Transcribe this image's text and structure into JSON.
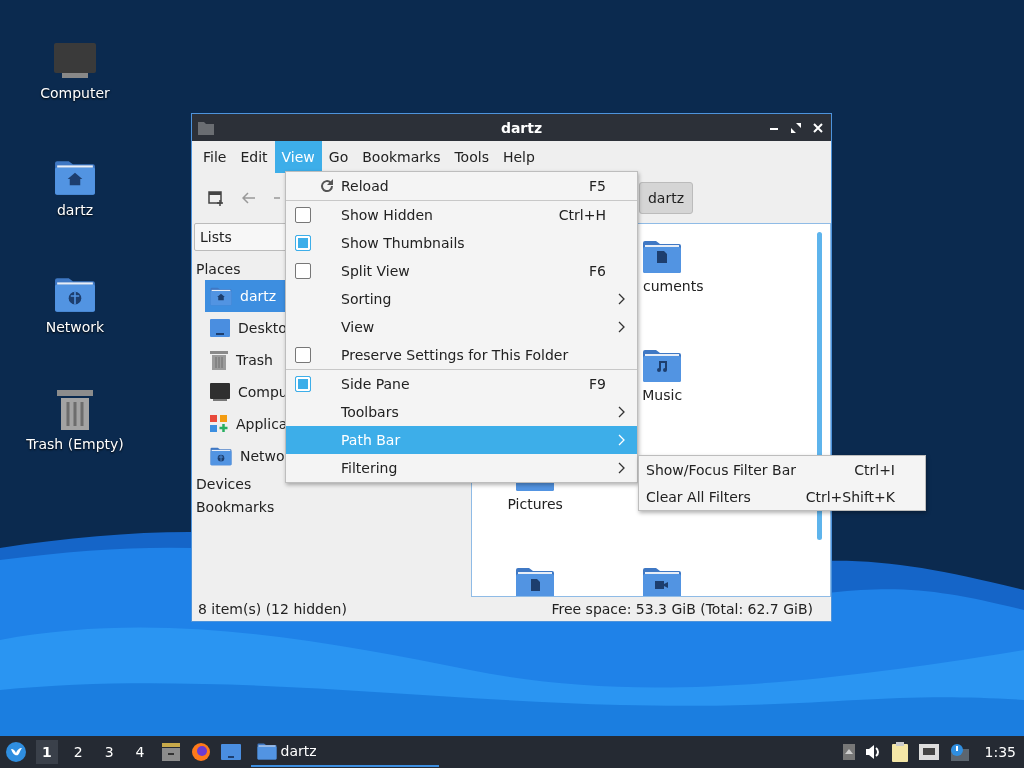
{
  "desktop": {
    "icons": [
      {
        "label": "Computer",
        "kind": "computer"
      },
      {
        "label": "dartz",
        "kind": "home"
      },
      {
        "label": "Network",
        "kind": "network"
      },
      {
        "label": "Trash (Empty)",
        "kind": "trash"
      }
    ]
  },
  "window": {
    "title": "dartz",
    "menubar": [
      {
        "label": "File",
        "selected": false
      },
      {
        "label": "Edit",
        "selected": false
      },
      {
        "label": "View",
        "selected": true
      },
      {
        "label": "Go",
        "selected": false
      },
      {
        "label": "Bookmarks",
        "selected": false
      },
      {
        "label": "Tools",
        "selected": false
      },
      {
        "label": "Help",
        "selected": false
      }
    ],
    "toolbar": {
      "path_button": "dartz"
    },
    "sidebar": {
      "selector": "Lists",
      "sections": [
        {
          "title": "Places",
          "items": [
            {
              "label": "dartz",
              "kind": "home",
              "selected": true
            },
            {
              "label": "Deskto",
              "kind": "desktop",
              "selected": false
            },
            {
              "label": "Trash",
              "kind": "trash",
              "selected": false
            },
            {
              "label": "Compu",
              "kind": "computer",
              "selected": false
            },
            {
              "label": "Applica",
              "kind": "applications",
              "selected": false
            },
            {
              "label": "Netwo",
              "kind": "network",
              "selected": false
            }
          ]
        },
        {
          "title": "Devices"
        },
        {
          "title": "Bookmarks"
        }
      ]
    },
    "files": [
      {
        "label": "cuments",
        "kind": "documents"
      },
      {
        "label": "Music",
        "kind": "music"
      },
      {
        "label": "Pictures",
        "kind": "pictures"
      },
      {
        "kind": "templates"
      },
      {
        "kind": "videos"
      }
    ],
    "status_bar": {
      "left": "8 item(s) (12 hidden)",
      "right": "Free space: 53.3 GiB (Total: 62.7 GiB)"
    }
  },
  "view_menu": {
    "items": [
      {
        "label": "Reload",
        "kind": "action",
        "shortcut": "F5",
        "selected": false
      },
      {
        "kind": "separator"
      },
      {
        "label": "Show Hidden",
        "kind": "check",
        "checked": false,
        "shortcut": "Ctrl+H",
        "selected": false
      },
      {
        "label": "Show Thumbnails",
        "kind": "check",
        "checked": true,
        "selected": false
      },
      {
        "label": "Split View",
        "kind": "check",
        "checked": false,
        "shortcut": "F6",
        "selected": false
      },
      {
        "label": "Sorting",
        "kind": "submenu",
        "selected": false
      },
      {
        "label": "View",
        "kind": "submenu",
        "selected": false
      },
      {
        "label": "Preserve Settings for This Folder",
        "kind": "check",
        "checked": false,
        "selected": false
      },
      {
        "kind": "separator"
      },
      {
        "label": "Side Pane",
        "kind": "check",
        "checked": true,
        "shortcut": "F9",
        "selected": false
      },
      {
        "label": "Toolbars",
        "kind": "submenu",
        "selected": false
      },
      {
        "label": "Path Bar",
        "kind": "submenu",
        "selected": true
      },
      {
        "label": "Filtering",
        "kind": "submenu",
        "selected": false
      }
    ]
  },
  "filtering_submenu": {
    "items": [
      {
        "label": "Show/Focus Filter Bar",
        "shortcut": "Ctrl+I"
      },
      {
        "label": "Clear All Filters",
        "shortcut": "Ctrl+Shift+K"
      }
    ]
  },
  "taskbar": {
    "workspaces": [
      {
        "label": "1",
        "selected": true
      },
      {
        "label": "2",
        "selected": false
      },
      {
        "label": "3",
        "selected": false
      },
      {
        "label": "4",
        "selected": false
      }
    ],
    "tasks": [
      {
        "label": "dartz"
      }
    ],
    "clock": "1:35"
  }
}
